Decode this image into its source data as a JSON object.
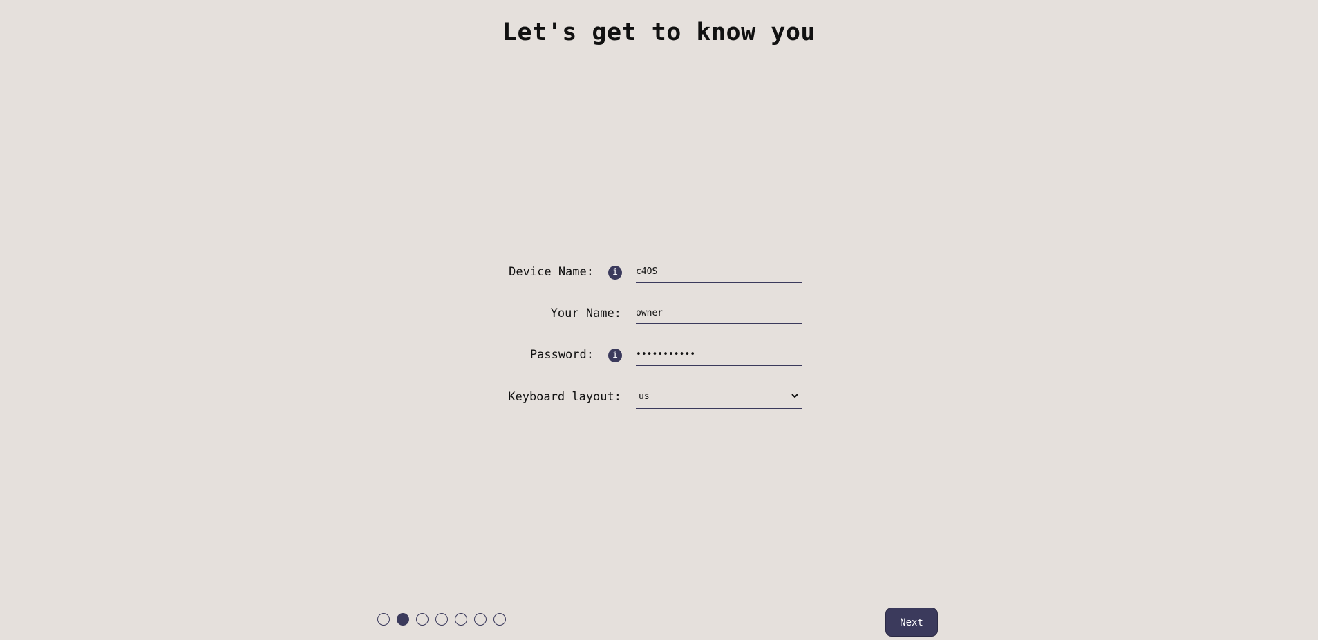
{
  "header": {
    "title": "Let's get to know you"
  },
  "form": {
    "device_name": {
      "label": "Device Name:",
      "info_icon": "i",
      "value": "c4OS"
    },
    "your_name": {
      "label": "Your Name:",
      "value": "owner"
    },
    "password": {
      "label": "Password:",
      "info_icon": "i",
      "masked_value": "•••••••••••"
    },
    "keyboard_layout": {
      "label": "Keyboard layout:",
      "selected": "us"
    }
  },
  "progress": {
    "total_steps": 7,
    "current_step": 2
  },
  "footer": {
    "next_label": "Next"
  },
  "colors": {
    "background": "#e5e0dc",
    "accent": "#3b3a5c"
  }
}
